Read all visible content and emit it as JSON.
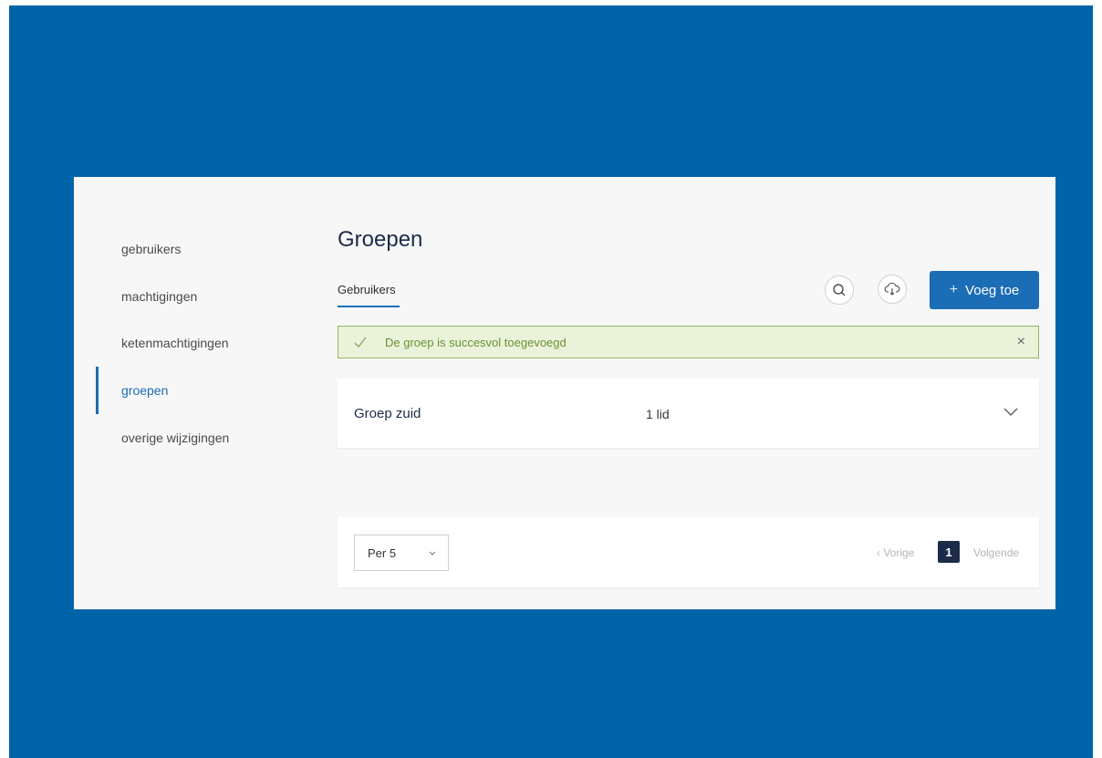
{
  "sidebar": {
    "items": [
      {
        "label": "gebruikers"
      },
      {
        "label": "machtigingen"
      },
      {
        "label": "ketenmachtigingen"
      },
      {
        "label": "groepen",
        "active": true
      },
      {
        "label": "overige wijzigingen"
      }
    ]
  },
  "header": {
    "title": "Groepen",
    "tab": "Gebruikers",
    "search_icon": "search-icon",
    "download_icon": "cloud-download-icon",
    "add_button": {
      "plus": "+",
      "label": "Voeg toe"
    }
  },
  "alert": {
    "message": "De groep is succesvol toegevoegd",
    "close": "×"
  },
  "groups": [
    {
      "name": "Groep zuid",
      "members": "1 lid"
    }
  ],
  "pagination": {
    "per_page": "Per 5",
    "prev": "‹ Vorige",
    "current": "1",
    "next": "Volgende"
  },
  "colors": {
    "frame": "#0064a8",
    "accent": "#1b6db5",
    "navy": "#1c2b4a",
    "success_bg": "#eaf3da",
    "success_border": "#98b45c"
  }
}
